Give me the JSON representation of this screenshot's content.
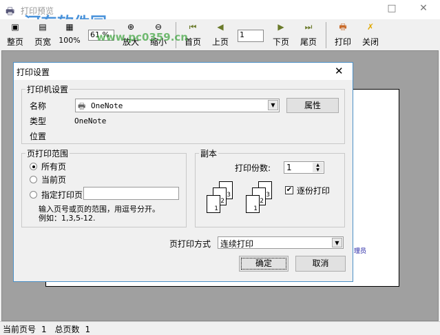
{
  "window": {
    "title": "打印预览",
    "maximize": "□",
    "close": "✕"
  },
  "watermark": {
    "name": "河东软件园",
    "url": "www.pc0359.cn"
  },
  "toolbar": {
    "whole_page": "整页",
    "page_width": "页宽",
    "actual_size": "100%",
    "zoom_value": "61 %",
    "zoom_in": "放大",
    "zoom_out": "缩小",
    "first": "首页",
    "prev": "上页",
    "page_input": "1",
    "next": "下页",
    "last": "尾页",
    "print": "打印",
    "close": "关闭"
  },
  "preview": {
    "partial_text": "理员"
  },
  "status": {
    "current_label": "当前页号",
    "current": "1",
    "total_label": "总页数",
    "total": "1"
  },
  "dialog": {
    "title": "打印设置",
    "close": "✕",
    "printer_group": "打印机设置",
    "name_label": "名称",
    "printer_name": "OneNote",
    "properties": "属性",
    "type_label": "类型",
    "type_value": "OneNote",
    "location_label": "位置",
    "range_group": "页打印范围",
    "all_pages": "所有页",
    "current_page": "当前页",
    "specified_pages": "指定打印页",
    "specified_value": "",
    "hint1": "输入页号或页的范围，用逗号分开。",
    "hint2": "例如：1,3,5-12.",
    "copies_group": "副本",
    "copies_label": "打印份数:",
    "copies_value": "1",
    "collate": "逐份打印",
    "collate_checked": true,
    "mode_label": "页打印方式",
    "mode_value": "连续打印",
    "ok": "确定",
    "cancel": "取消"
  }
}
